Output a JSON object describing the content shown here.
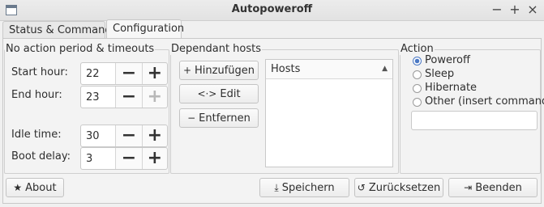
{
  "window": {
    "title": "Autopoweroff",
    "controls": [
      "−",
      "+",
      "×"
    ]
  },
  "tabs": [
    "Status & Commands",
    "Configuration"
  ],
  "timeouts": {
    "title": "No action period & timeouts",
    "start_label": "Start hour:",
    "start_value": "22",
    "end_label": "End hour:",
    "end_value": "23",
    "idle_label": "Idle time:",
    "idle_value": "30",
    "boot_label": "Boot delay:",
    "boot_value": "3",
    "minus": "−",
    "plus": "+"
  },
  "hosts": {
    "title": "Dependant hosts",
    "add": "Hinzufügen",
    "edit": "Edit",
    "remove": "Entfernen",
    "column": "Hosts",
    "add_icon": "+",
    "edit_icon": "<·>",
    "remove_icon": "−",
    "sort_icon": "▲"
  },
  "action": {
    "title": "Action",
    "options": [
      "Poweroff",
      "Sleep",
      "Hibernate",
      "Other (insert command)"
    ],
    "selected_index": 0,
    "command_value": ""
  },
  "footer": {
    "about": "About",
    "save": "Speichern",
    "reset": "Zurücksetzen",
    "quit": "Beenden",
    "about_icon": "★",
    "save_icon": "⤓",
    "reset_icon": "↺",
    "quit_icon": "⇥"
  }
}
